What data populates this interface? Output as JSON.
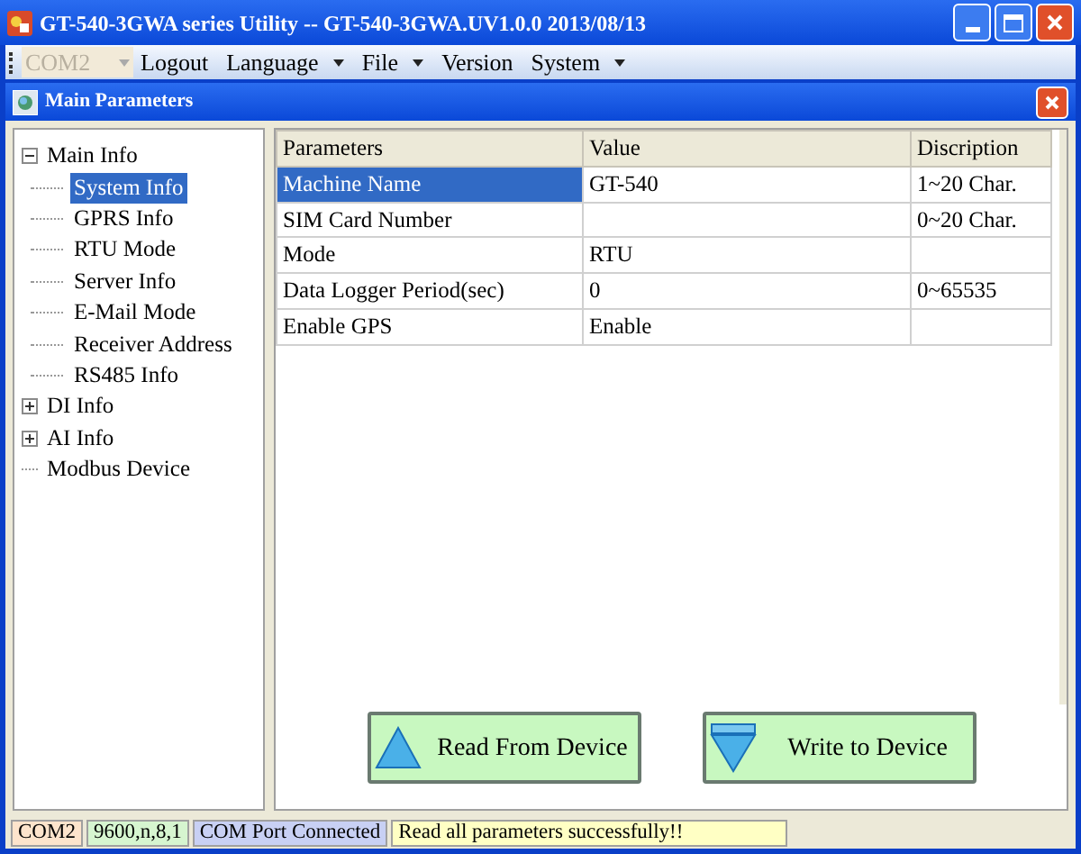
{
  "window": {
    "title": "GT-540-3GWA series Utility -- GT-540-3GWA.UV1.0.0 2013/08/13"
  },
  "menubar": {
    "port_combo": {
      "value": "COM2",
      "disabled": true
    },
    "items": [
      {
        "label": "Logout",
        "has_dropdown": false
      },
      {
        "label": "Language",
        "has_dropdown": true
      },
      {
        "label": "File",
        "has_dropdown": true
      },
      {
        "label": "Version",
        "has_dropdown": false
      },
      {
        "label": "System",
        "has_dropdown": true
      }
    ]
  },
  "child_window": {
    "title": "Main Parameters"
  },
  "tree": [
    {
      "label": "Main Info",
      "expanded": true,
      "selected": false,
      "children": [
        {
          "label": "System Info",
          "selected": true
        },
        {
          "label": "GPRS Info",
          "selected": false
        },
        {
          "label": "RTU Mode",
          "selected": false
        },
        {
          "label": "Server Info",
          "selected": false
        },
        {
          "label": "E-Mail Mode",
          "selected": false
        },
        {
          "label": "Receiver Address",
          "selected": false
        },
        {
          "label": "RS485 Info",
          "selected": false
        }
      ]
    },
    {
      "label": "DI Info",
      "expanded": false,
      "selected": false
    },
    {
      "label": "AI Info",
      "expanded": false,
      "selected": false
    },
    {
      "label": "Modbus Device",
      "selected": false
    }
  ],
  "table": {
    "columns": [
      "Parameters",
      "Value",
      "Discription"
    ],
    "rows": [
      {
        "selected": true,
        "cells": [
          "Machine Name",
          "GT-540",
          "1~20 Char."
        ]
      },
      {
        "selected": false,
        "cells": [
          "SIM Card Number",
          "",
          "0~20 Char."
        ]
      },
      {
        "selected": false,
        "cells": [
          "Mode",
          "RTU",
          ""
        ]
      },
      {
        "selected": false,
        "cells": [
          "Data Logger Period(sec)",
          "0",
          "0~65535"
        ]
      },
      {
        "selected": false,
        "cells": [
          "Enable GPS",
          "Enable",
          ""
        ]
      }
    ]
  },
  "buttons": [
    {
      "label": "Read From Device",
      "kind": "read"
    },
    {
      "label": "Write to Device",
      "kind": "write"
    }
  ],
  "status_bar": [
    {
      "text": "COM2",
      "color": "#fde4cc"
    },
    {
      "text": "9600,n,8,1",
      "color": "#d6f5d0"
    },
    {
      "text": "COM Port Connected",
      "color": "#c8d0f4"
    },
    {
      "text": "Read all parameters successfully!!",
      "color": "#ffffc4"
    }
  ]
}
